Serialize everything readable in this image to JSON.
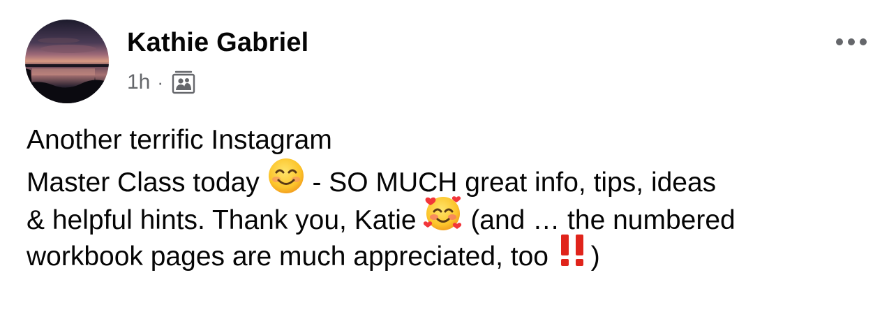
{
  "author": {
    "name": "Kathie Gabriel"
  },
  "meta": {
    "time": "1h",
    "separator": "·",
    "audience_icon": "photo-album-icon"
  },
  "actions": {
    "more_icon": "more-options-icon"
  },
  "post": {
    "line1": "Another terrific Instagram",
    "line2_a": "Master Class today",
    "line2_b": " - SO MUCH  great info, tips, ideas",
    "line3_a": "& helpful hints.  Thank you, Katie",
    "line3_b": " (and … the numbered",
    "line4_a": "workbook pages are much appreciated, too",
    "line4_b": ")",
    "emojis": [
      "smiling-face-with-smiling-eyes",
      "smiling-face-with-hearts",
      "double-exclamation-mark"
    ]
  },
  "colors": {
    "name": "#050505",
    "meta": "#65676b",
    "exclamation": "#e0241b"
  }
}
